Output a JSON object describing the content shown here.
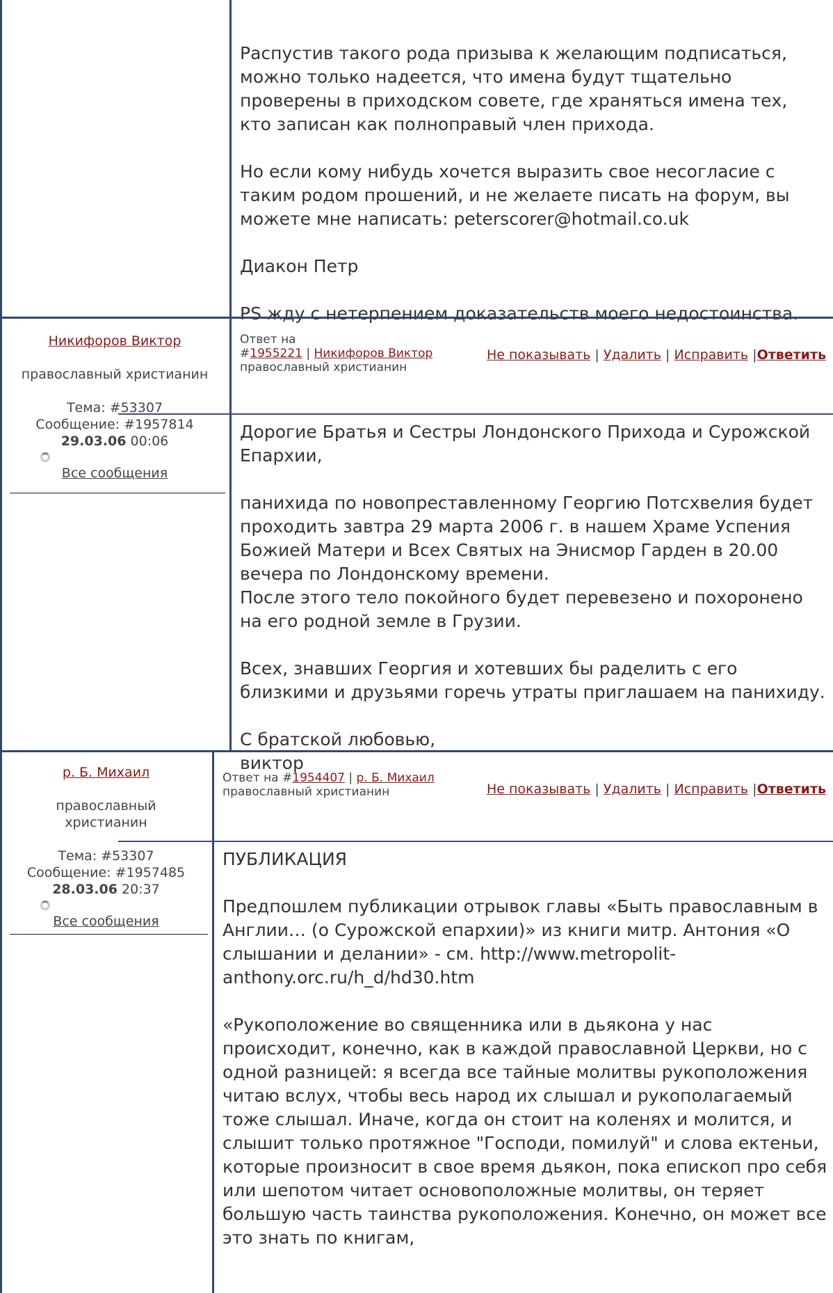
{
  "post1": {
    "paragraphs": [
      "Распустив такого рода призыва к желающим подписаться, можно только надеется, что имена будут тщательно проверены в приходском совете, где храняться имена тех, кто записан как полноправый член прихода.",
      "Но если кому нибудь хочется выразить свое несогласие с таким родом прошений, и не желаете писать на форум, вы можете мне написать: peterscorer@hotmail.co.uk",
      "Диакон Петр",
      "PS жду с нетерпением доказательств моего недостоинства."
    ]
  },
  "post2": {
    "author": "Никифоров Виктор",
    "role": "православный христианин",
    "topic_label": "Тема: #53307",
    "message_label": "Сообщение: #1957814",
    "date": "29.03.06",
    "time": "00:06",
    "all_messages": "Все сообщения",
    "reply_to_prefix": "Ответ на",
    "reply_to_hash": "#",
    "reply_to_id": "1955221",
    "reply_author": "Никифоров Виктор",
    "reply_role": "православный христианин",
    "action_hide": "Не показывать",
    "action_delete": "Удалить",
    "action_edit": "Исправить",
    "action_reply": "Ответить",
    "paragraphs": [
      "Дорогие Братья и Сестры Лондонского Прихода и Сурожской Епархии,",
      "панихида по новопреставленному Георгию Потсхвелия будет проходить завтра 29 марта 2006 г. в нашем Храме Успения Божией Матери и Всех Святых на Энисмор Гарден в 20.00 вечера по Лондонскому времени.",
      "После этого тело покойного будет перевезено и похоронено на его родной земле в Грузии.",
      "Всех, знавших Георгия и хотевших бы раделить с его близкими и друзьями горечь утраты приглашаем на панихиду.",
      "С братской любовью,",
      "виктор"
    ]
  },
  "post3": {
    "author": "р. Б. Михаил",
    "role": "православный христианин",
    "topic_label": "Тема: #53307",
    "message_label": "Сообщение: #1957485",
    "date": "28.03.06",
    "time": "20:37",
    "all_messages": "Все сообщения",
    "reply_to_prefix": "Ответ на",
    "reply_to_hash": "#",
    "reply_to_id": "1954407",
    "reply_author": "р. Б. Михаил",
    "reply_role": "православный христианин",
    "action_hide": "Не показывать",
    "action_delete": "Удалить",
    "action_edit": "Исправить",
    "action_reply": "Ответить",
    "paragraphs": [
      "ПУБЛИКАЦИЯ",
      "Предпошлем публикации отрывок главы «Быть православным в Англии… (о Сурожской епархии)» из книги митр. Антония «О слышании и делании» - см. http://www.metropolit-anthony.orc.ru/h_d/hd30.htm",
      "«Рукоположение во священника или в дьякона у нас происходит, конечно, как в каждой православной Церкви, но с одной разницей: я всегда все тайные молитвы рукоположения читаю вслух, чтобы весь народ их слышал и рукополагаемый тоже слышал. Иначе, когда он стоит на коленях и молится, и слышит только протяжное \"Господи, помилуй\" и слова ектеньи, которые произносит в свое время дьякон, пока епископ про себя или шепотом читает основоположные молитвы, он теряет большую часть таинства рукоположения. Конечно, он может все это знать по книгам,"
    ]
  },
  "separator": "|"
}
